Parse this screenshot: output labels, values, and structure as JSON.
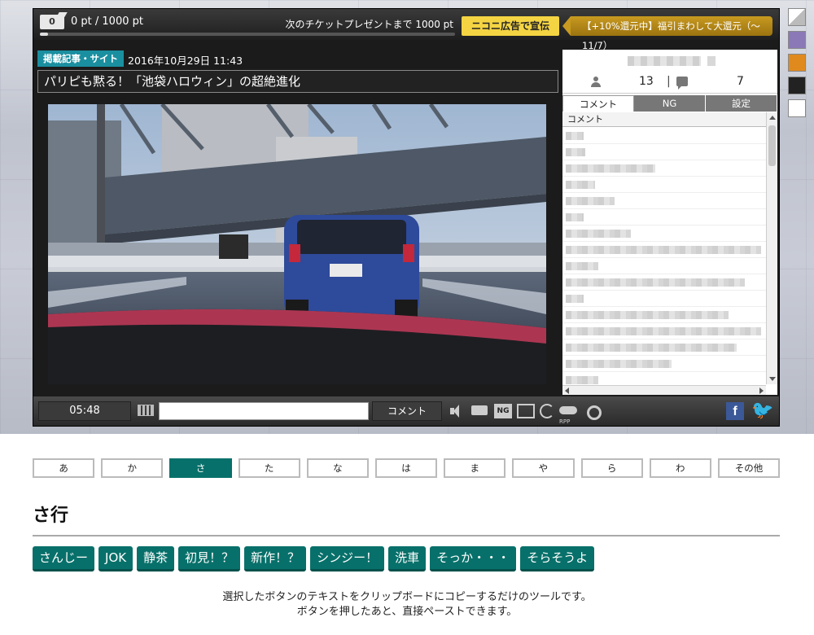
{
  "topbar": {
    "points_icon": "0",
    "points_text": "0 pt / 1000 pt",
    "points_fraction": 0.02,
    "next_ticket": "次のチケットプレゼントまで 1000 pt",
    "ad_button": "ニコニ広告で宣伝",
    "campaign": "【+10%還元中】福引まわして大還元（〜11/7）"
  },
  "info": {
    "category": "掲載記事・サイト",
    "datetime": "2016年10月29日 11:43",
    "title": "パリピも黙る！「池袋ハロウィン」の超絶進化"
  },
  "side": {
    "user_count": "13",
    "divider": "|",
    "comment_count": "7",
    "tabs": [
      "コメント",
      "NG",
      "設定"
    ],
    "column_header": "コメント"
  },
  "controls": {
    "time": "05:48",
    "comment_button": "コメント",
    "ng_label": "NG",
    "rpp_label": "RPP",
    "fb_label": "f",
    "tw_label": "🐦"
  },
  "kana_tabs": [
    "あ",
    "か",
    "さ",
    "た",
    "な",
    "は",
    "ま",
    "や",
    "ら",
    "わ",
    "その他"
  ],
  "kana_active_index": 2,
  "section_title": "さ行",
  "phrases": [
    "さんじー",
    "JOK",
    "静茶",
    "初見！？",
    "新作！？",
    "シンジー！",
    "洗車",
    "そっか・・・",
    "そらそうよ"
  ],
  "note": {
    "line1": "選択したボタンのテキストをクリップボードにコピーするだけのツールです。",
    "line2": "ボタンを押したあと、直接ペーストできます。"
  },
  "colors": {
    "accent": "#08706a",
    "ad_yellow": "#f4d443",
    "campaign_gold": "#b8860b",
    "category_teal": "#1a8fa0"
  }
}
